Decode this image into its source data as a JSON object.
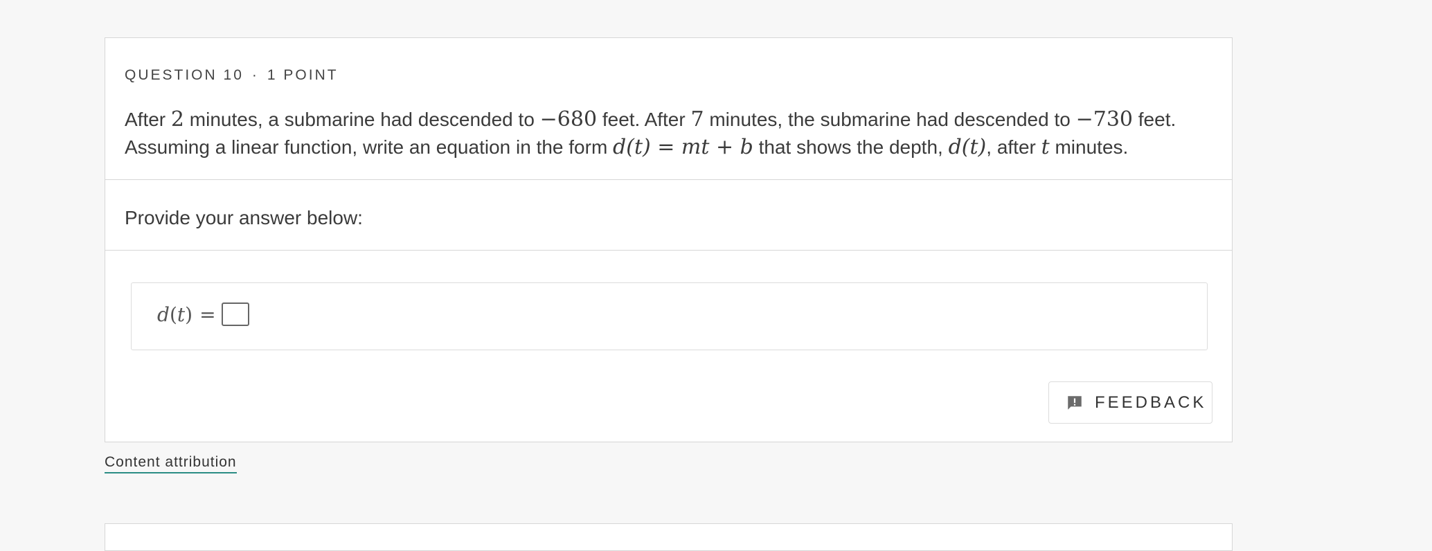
{
  "question": {
    "number_label": "QUESTION 10",
    "separator": "·",
    "points_label": "1 POINT",
    "text": {
      "p1": "After ",
      "m1": "2",
      "p2": " minutes, a submarine had descended to ",
      "m2": "−680",
      "p3": " feet. After ",
      "m3": "7",
      "p4": " minutes, the submarine had descended to ",
      "m4": "−730",
      "p5": " feet. Assuming a linear function, write an equation in the form ",
      "m5": "d(t) = mt + b",
      "p6": " that shows the depth, ",
      "m6": "d(t)",
      "p7": ", after ",
      "m7": "t",
      "p8": " minutes."
    }
  },
  "answer": {
    "prompt": "Provide your answer below:",
    "lhs_var": "d",
    "lhs_open": "(",
    "lhs_arg": "t",
    "lhs_close": ")",
    "equals": "="
  },
  "feedback": {
    "label": "FEEDBACK",
    "icon": "feedback-exclamation-icon"
  },
  "attribution": {
    "label": "Content attribution"
  },
  "colors": {
    "background": "#f7f7f7",
    "card": "#ffffff",
    "border": "#d6d6d6",
    "link_underline": "#2b8c84",
    "icon": "#6b6b6b"
  }
}
